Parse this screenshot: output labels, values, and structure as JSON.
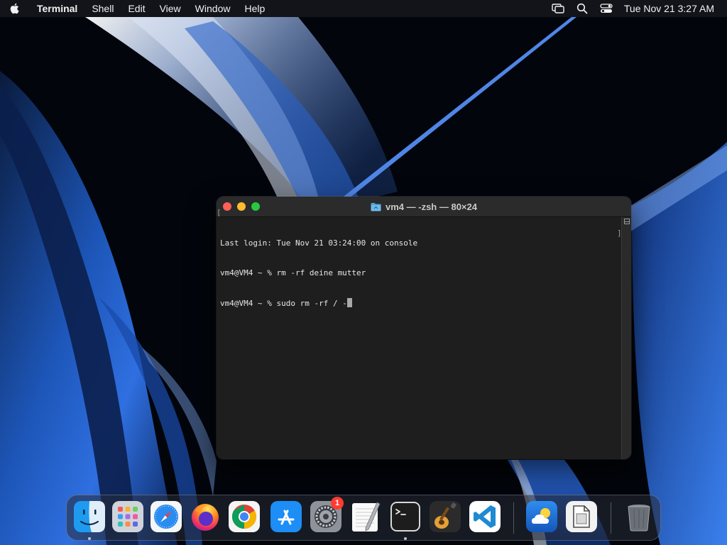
{
  "menubar": {
    "app_name": "Terminal",
    "items": [
      "Shell",
      "Edit",
      "View",
      "Window",
      "Help"
    ],
    "clock": "Tue Nov 21  3:27 AM"
  },
  "terminal": {
    "title": "vm4 — -zsh — 80×24",
    "lines": [
      "Last login: Tue Nov 21 03:24:00 on console",
      "vm4@VM4 ~ % rm -rf deine mutter",
      "vm4@VM4 ~ % sudo rm -rf / -"
    ],
    "bracket_left": "[",
    "bracket_right": "]"
  },
  "dock": {
    "apps": [
      {
        "name": "Finder",
        "icon": "finder-icon",
        "running": true
      },
      {
        "name": "Launchpad",
        "icon": "launchpad-icon",
        "running": false
      },
      {
        "name": "Safari",
        "icon": "safari-icon",
        "running": false
      },
      {
        "name": "Firefox",
        "icon": "firefox-icon",
        "running": false
      },
      {
        "name": "Google Chrome",
        "icon": "chrome-icon",
        "running": false
      },
      {
        "name": "App Store",
        "icon": "app-store-icon",
        "running": false
      },
      {
        "name": "System Settings",
        "icon": "settings-icon",
        "running": false,
        "badge": "1"
      },
      {
        "name": "TextEdit",
        "icon": "textedit-icon",
        "running": false
      },
      {
        "name": "Terminal",
        "icon": "terminal-icon",
        "running": true
      },
      {
        "name": "GarageBand",
        "icon": "guitar-icon",
        "running": false
      },
      {
        "name": "Visual Studio Code",
        "icon": "vscode-icon",
        "running": false
      },
      {
        "name": "Weather",
        "icon": "weather-icon",
        "running": false
      },
      {
        "name": "Preview",
        "icon": "preview-icon",
        "running": false
      },
      {
        "name": "Trash",
        "icon": "trash-icon",
        "running": false
      }
    ]
  },
  "colors": {
    "close": "#fe5f57",
    "minimize": "#febc2e",
    "maximize": "#28c840",
    "badge": "#ff3b30"
  }
}
